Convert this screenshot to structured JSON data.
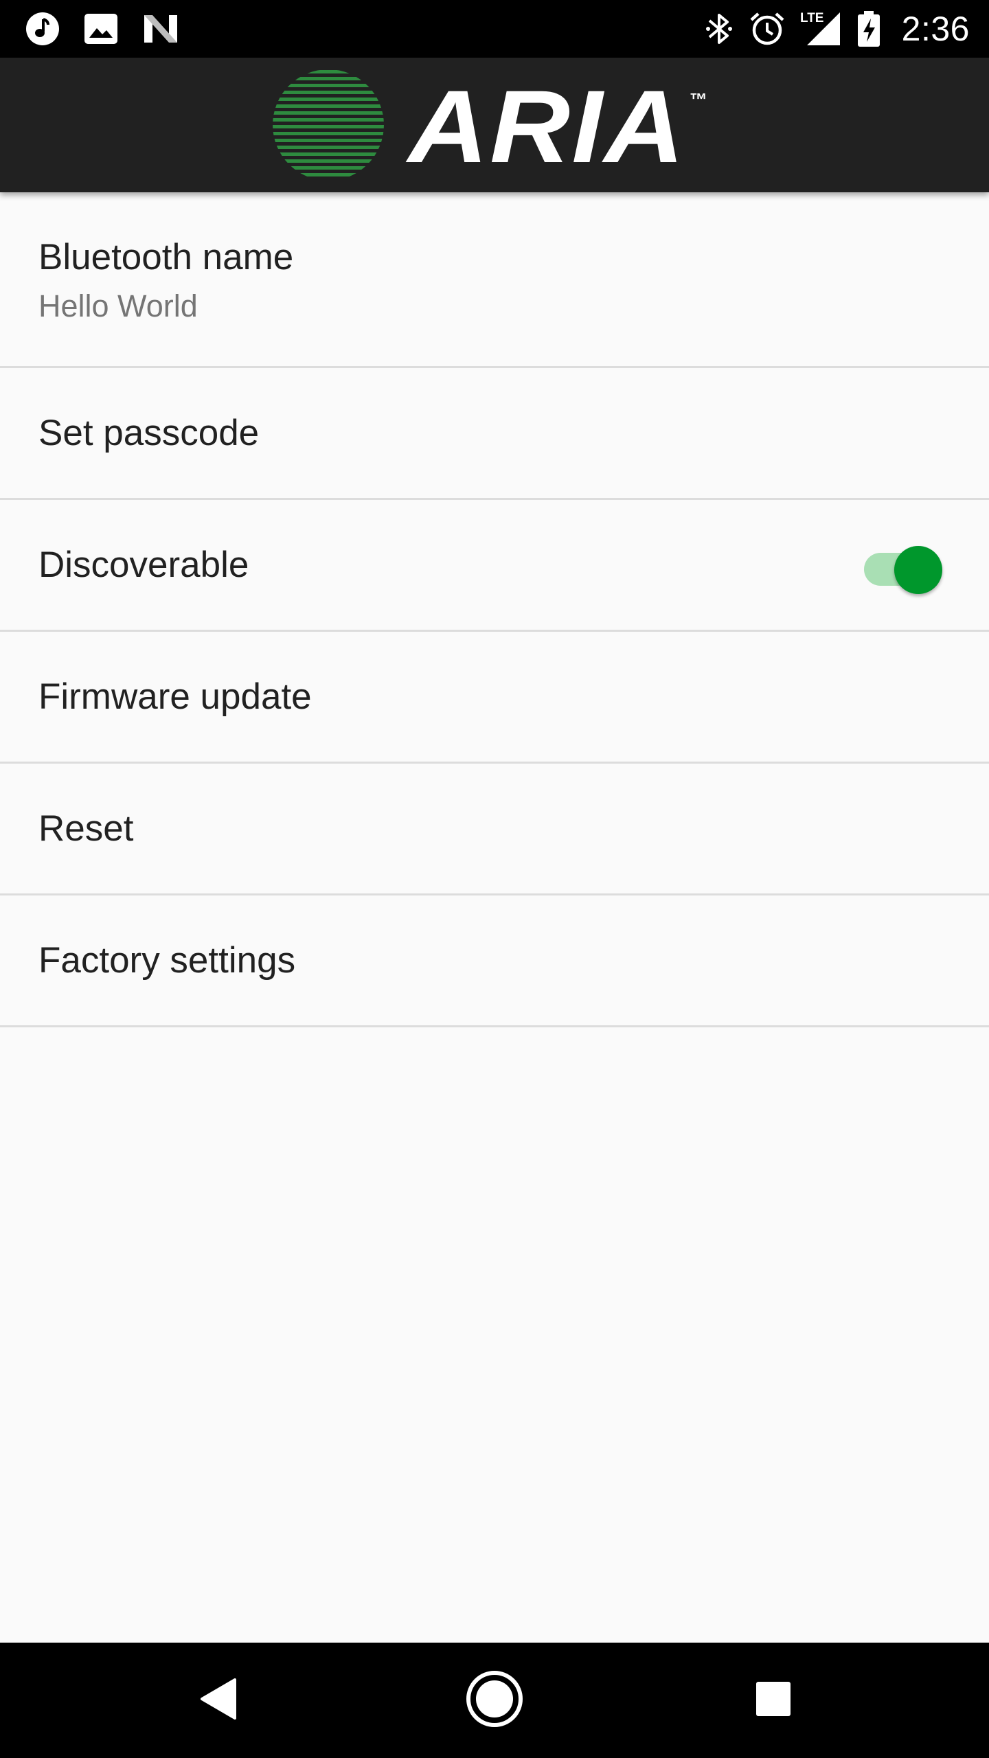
{
  "status_bar": {
    "left_icons": [
      "music-note-icon",
      "image-icon",
      "n-logo-icon"
    ],
    "right_icons": [
      "bluetooth-icon",
      "alarm-icon",
      "lte-signal-icon",
      "battery-charging-icon"
    ],
    "network_label": "LTE",
    "time": "2:36"
  },
  "app_bar": {
    "logo_text": "ARIA",
    "logo_trademark": "™",
    "logo_globe_color": "#2e8b3f"
  },
  "settings": {
    "items": [
      {
        "title": "Bluetooth name",
        "summary": "Hello World"
      },
      {
        "title": "Set passcode"
      },
      {
        "title": "Discoverable",
        "toggle": true
      },
      {
        "title": "Firmware update"
      },
      {
        "title": "Reset"
      },
      {
        "title": "Factory settings"
      }
    ]
  },
  "colors": {
    "accent": "#00972c",
    "switch_track": "#a9dfb4",
    "app_bar_bg": "#212121",
    "background": "#fafafa"
  },
  "nav_bar": {
    "icons": [
      "back-icon",
      "home-icon",
      "recents-icon"
    ]
  }
}
